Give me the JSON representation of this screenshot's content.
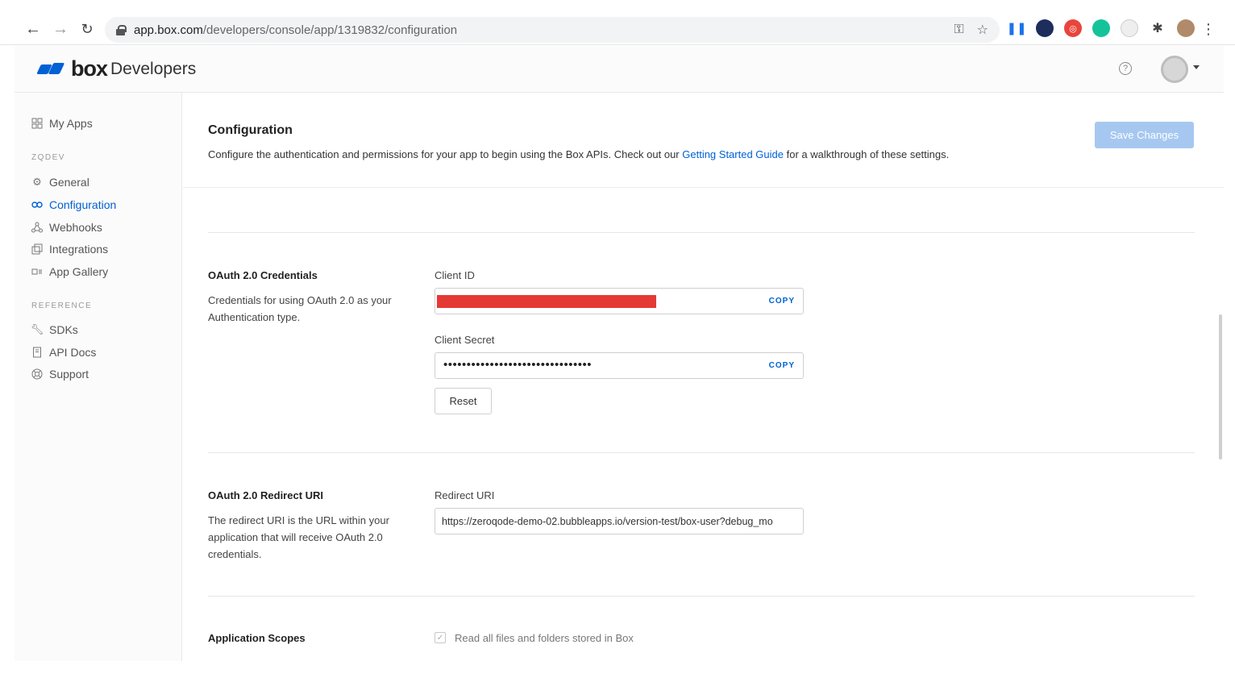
{
  "browser": {
    "url_host": "app.box.com",
    "url_path": "/developers/console/app/1319832/configuration"
  },
  "header": {
    "logo_box": "box",
    "logo_developers": "Developers",
    "help_glyph": "?"
  },
  "sidebar": {
    "my_apps": "My Apps",
    "org_heading": "ZQDEV",
    "items": [
      {
        "label": "General",
        "icon": "gear-icon"
      },
      {
        "label": "Configuration",
        "icon": "key-icon"
      },
      {
        "label": "Webhooks",
        "icon": "webhook-icon"
      },
      {
        "label": "Integrations",
        "icon": "integrations-icon"
      },
      {
        "label": "App Gallery",
        "icon": "gallery-icon"
      }
    ],
    "reference_heading": "REFERENCE",
    "reference_items": [
      {
        "label": "SDKs",
        "icon": "wrench-icon"
      },
      {
        "label": "API Docs",
        "icon": "document-icon"
      },
      {
        "label": "Support",
        "icon": "support-icon"
      }
    ]
  },
  "page": {
    "title": "Configuration",
    "desc_before": "Configure the authentication and permissions for your app to begin using the Box APIs. Check out our ",
    "desc_link": "Getting Started Guide",
    "desc_after": " for a walkthrough of these settings.",
    "save_label": "Save Changes"
  },
  "credentials": {
    "title": "OAuth 2.0 Credentials",
    "desc": "Credentials for using OAuth 2.0 as your Authentication type.",
    "client_id_label": "Client ID",
    "client_secret_label": "Client Secret",
    "client_secret_value": "••••••••••••••••••••••••••••••••",
    "copy_label": "COPY",
    "reset_label": "Reset"
  },
  "redirect": {
    "title": "OAuth 2.0 Redirect URI",
    "desc": "The redirect URI is the URL within your application that will receive OAuth 2.0 credentials.",
    "label": "Redirect URI",
    "value": "https://zeroqode-demo-02.bubbleapps.io/version-test/box-user?debug_mo"
  },
  "scopes": {
    "title": "Application Scopes",
    "read_files_label": "Read all files and folders stored in Box",
    "read_files_checked": true
  },
  "colors": {
    "accent": "#0061d5",
    "save_disabled": "#a6c8f0",
    "redaction": "#e53935"
  }
}
